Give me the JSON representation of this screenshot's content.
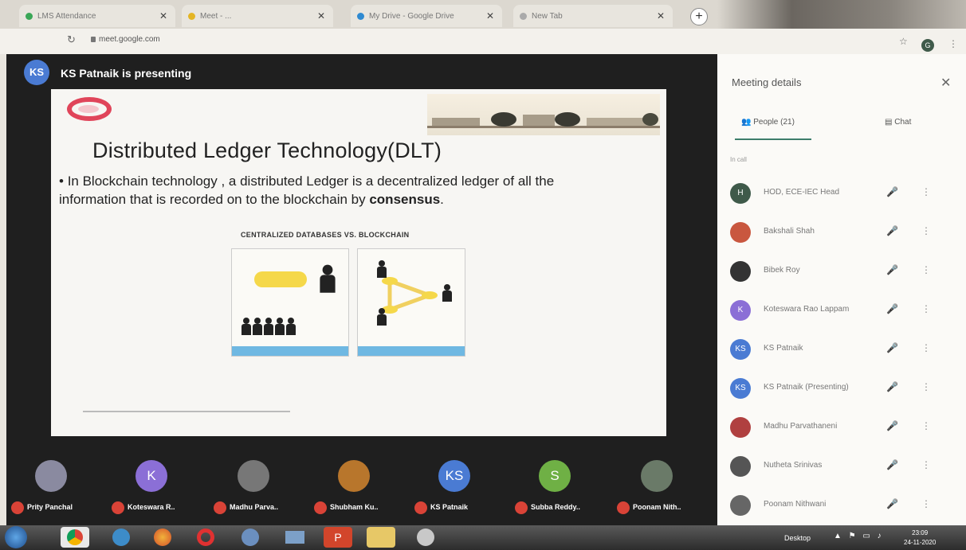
{
  "browser": {
    "tabs": [
      {
        "label": "LMS Attendance",
        "color": "#3aa757"
      },
      {
        "label": "Meet - ...",
        "color": "#e4b524"
      },
      {
        "label": "My Drive - Google Drive",
        "color": "#2f8ad1"
      },
      {
        "label": "New Tab",
        "color": "#aaaaaa"
      }
    ],
    "new_tab_icon": "+",
    "url": "meet.google.com",
    "reload_icon": "↻",
    "star_icon": "☆",
    "profile_initial": "G",
    "menu_icon": "⋮"
  },
  "presenter": {
    "initials": "KS",
    "banner": "KS Patnaik is presenting"
  },
  "slide": {
    "title": "Distributed Ledger Technology(DLT)",
    "bullet_prefix": "In Blockchain technology , a distributed Ledger is a decentralized ledger of all the information that is recorded on to the blockchain by ",
    "bullet_bold": "consensus",
    "bullet_suffix": ".",
    "diagram_title": "CENTRALIZED DATABASES VS. BLOCKCHAIN"
  },
  "participants_tiles": [
    {
      "name": "Prity Panchal",
      "initial": "",
      "color": "#8a8aa0"
    },
    {
      "name": "Koteswara R..",
      "initial": "K",
      "color": "#8b6fd6"
    },
    {
      "name": "Madhu Parva..",
      "initial": "",
      "color": "#777"
    },
    {
      "name": "Shubham Ku..",
      "initial": "",
      "color": "#b8762c"
    },
    {
      "name": "KS Patnaik",
      "initial": "KS",
      "color": "#4a7bd3"
    },
    {
      "name": "Subba Reddy..",
      "initial": "S",
      "color": "#6fb045"
    },
    {
      "name": "Poonam Nith..",
      "initial": "",
      "color": "#6a7a68"
    }
  ],
  "panel": {
    "title": "Meeting details",
    "close_icon": "✕",
    "tab_people": "People (21)",
    "tab_chat": "Chat",
    "section_label": "In call",
    "people": [
      {
        "name": "HOD, ECE-IEC Head",
        "initial": "H",
        "color": "#3f5a4a"
      },
      {
        "name": "Bakshali Shah",
        "initial": "",
        "color": "#c9573f"
      },
      {
        "name": "Bibek Roy",
        "initial": "",
        "color": "#333"
      },
      {
        "name": "Koteswara Rao Lappam",
        "initial": "K",
        "color": "#8b6fd6"
      },
      {
        "name": "KS Patnaik",
        "initial": "KS",
        "color": "#4a7bd3"
      },
      {
        "name": "KS Patnaik (Presenting)",
        "initial": "KS",
        "color": "#4a7bd3"
      },
      {
        "name": "Madhu Parvathaneni",
        "initial": "",
        "color": "#b04040"
      },
      {
        "name": "Nutheta Srinivas",
        "initial": "",
        "color": "#555"
      },
      {
        "name": "Poonam Nithwani",
        "initial": "",
        "color": "#666"
      }
    ]
  },
  "taskbar": {
    "desktop_label": "Desktop",
    "time": "23:09",
    "date": "24-11-2020"
  }
}
